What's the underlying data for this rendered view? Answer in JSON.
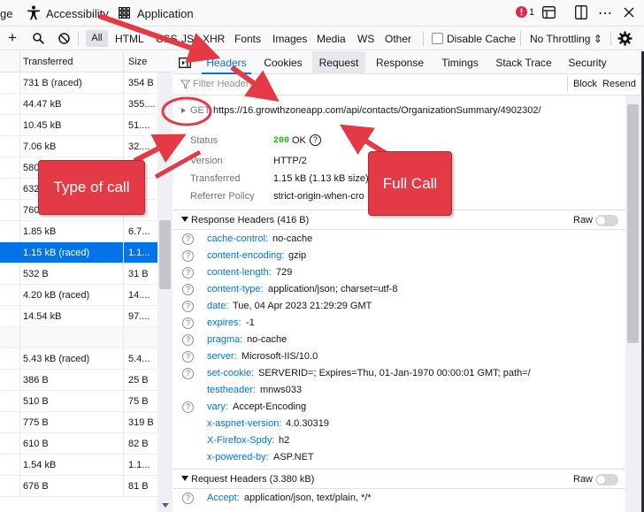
{
  "topbar": {
    "partial_label": "ge",
    "accessibility": "Accessibility",
    "application": "Application",
    "error_count": "1"
  },
  "toolbar": {
    "filters": [
      "All",
      "HTML",
      "CSS",
      "JS",
      "XHR",
      "Fonts",
      "Images",
      "Media",
      "WS",
      "Other"
    ],
    "disable_cache": "Disable Cache",
    "throttling": "No Throttling ⇕"
  },
  "request_table": {
    "col_transferred": "Transferred",
    "col_size": "Size",
    "rows": [
      {
        "transferred": "731 B (raced)",
        "size": "354 B"
      },
      {
        "transferred": "44.47 kB",
        "size": "355...."
      },
      {
        "transferred": "10.45 kB",
        "size": "51...."
      },
      {
        "transferred": "7.06 kB",
        "size": "32...."
      },
      {
        "transferred": "580",
        "size": ""
      },
      {
        "transferred": "632",
        "size": ""
      },
      {
        "transferred": "760",
        "size": ""
      },
      {
        "transferred": "1.85 kB",
        "size": "6.7..."
      },
      {
        "transferred": "1.15 kB (raced)",
        "size": "1.1..."
      },
      {
        "transferred": "532 B",
        "size": "31 B"
      },
      {
        "transferred": "4.20 kB (raced)",
        "size": "14...."
      },
      {
        "transferred": "14.54 kB",
        "size": "97...."
      },
      {
        "transferred": "",
        "size": ""
      },
      {
        "transferred": "5.43 kB (raced)",
        "size": "5.4..."
      },
      {
        "transferred": "386 B",
        "size": "25 B"
      },
      {
        "transferred": "510 B",
        "size": "75 B"
      },
      {
        "transferred": "775 B",
        "size": "319 B"
      },
      {
        "transferred": "610 B",
        "size": "82 B"
      },
      {
        "transferred": "1.54 kB",
        "size": "1.1..."
      },
      {
        "transferred": "676 B",
        "size": "81 B"
      }
    ]
  },
  "detail": {
    "tabs": [
      "Headers",
      "Cookies",
      "Request",
      "Response",
      "Timings",
      "Stack Trace",
      "Security"
    ],
    "filter_placeholder": "Filter Headers",
    "block": "Block",
    "resend": "Resend",
    "method": "GET",
    "url": "https://16.growthzoneapp.com/api/contacts/OrganizationSummary/4902302/",
    "status_label": "Status",
    "status_code": "200",
    "status_text": "OK",
    "version_label": "Version",
    "version": "HTTP/2",
    "transferred_label": "Transferred",
    "transferred": "1.15 kB (1.13 kB size)",
    "referrer_label": "Referrer Policy",
    "referrer": "strict-origin-when-cro",
    "response_headers_title": "Response Headers (416 B)",
    "raw": "Raw",
    "response_headers": [
      {
        "name": "cache-control:",
        "value": "no-cache",
        "q": true
      },
      {
        "name": "content-encoding:",
        "value": "gzip",
        "q": true
      },
      {
        "name": "content-length:",
        "value": "729",
        "q": true
      },
      {
        "name": "content-type:",
        "value": "application/json; charset=utf-8",
        "q": true
      },
      {
        "name": "date:",
        "value": "Tue, 04 Apr 2023 21:29:29 GMT",
        "q": true
      },
      {
        "name": "expires:",
        "value": "-1",
        "q": true
      },
      {
        "name": "pragma:",
        "value": "no-cache",
        "q": true
      },
      {
        "name": "server:",
        "value": "Microsoft-IIS/10.0",
        "q": true
      },
      {
        "name": "set-cookie:",
        "value": "SERVERID=; Expires=Thu, 01-Jan-1970 00:00:01 GMT; path=/",
        "q": true
      },
      {
        "name": "testheader:",
        "value": "mnws033",
        "q": false
      },
      {
        "name": "vary:",
        "value": "Accept-Encoding",
        "q": true
      },
      {
        "name": "x-aspnet-version:",
        "value": "4.0.30319",
        "q": false
      },
      {
        "name": "X-Firefox-Spdy:",
        "value": "h2",
        "q": false
      },
      {
        "name": "x-powered-by:",
        "value": "ASP.NET",
        "q": false
      }
    ],
    "request_headers_title": "Request Headers (3.380 kB)",
    "request_headers": [
      {
        "name": "Accept:",
        "value": "application/json, text/plain, */*",
        "q": true
      }
    ]
  },
  "annotations": {
    "type_of_call": "Type of call",
    "full_call": "Full Call",
    "arrow_color": "#e43a45"
  }
}
